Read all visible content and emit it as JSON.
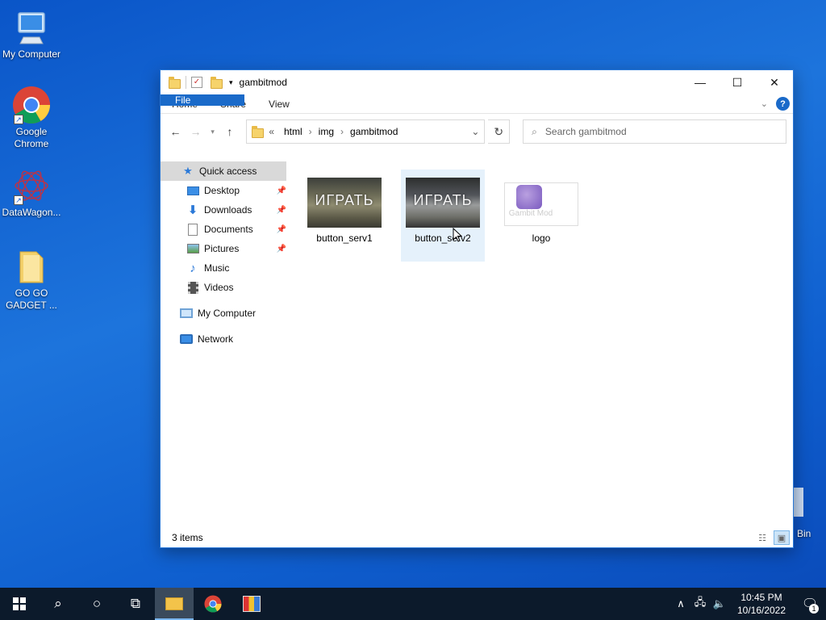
{
  "desktop": {
    "icons": [
      {
        "label": "My Computer"
      },
      {
        "label": "Google Chrome"
      },
      {
        "label": "DataWagon..."
      },
      {
        "label": "GO GO GADGET ..."
      }
    ],
    "recycle_label": "Bin"
  },
  "window": {
    "title": "gambitmod",
    "ribbon": {
      "tabs": [
        "File",
        "Home",
        "Share",
        "View"
      ]
    },
    "address": {
      "overflow": "«",
      "crumbs": [
        "html",
        "img",
        "gambitmod"
      ]
    },
    "search": {
      "placeholder": "Search gambitmod"
    },
    "navpane": {
      "quick_access": "Quick access",
      "items": [
        "Desktop",
        "Downloads",
        "Documents",
        "Pictures",
        "Music",
        "Videos"
      ],
      "my_computer": "My Computer",
      "network": "Network"
    },
    "files": [
      {
        "name": "button_serv1",
        "thumb_text": "ИГРАТЬ"
      },
      {
        "name": "button_serv2",
        "thumb_text": "ИГРАТЬ"
      },
      {
        "name": "logo",
        "thumb_text": "Gambit Mod"
      }
    ],
    "status": {
      "count": "3 items"
    }
  },
  "taskbar": {
    "time": "10:45 PM",
    "date": "10/16/2022",
    "notifications": "1"
  },
  "colors": {
    "accent": "#1a6ac9",
    "selection": "#e5f1fb",
    "taskbar": "#0c1a2b"
  }
}
